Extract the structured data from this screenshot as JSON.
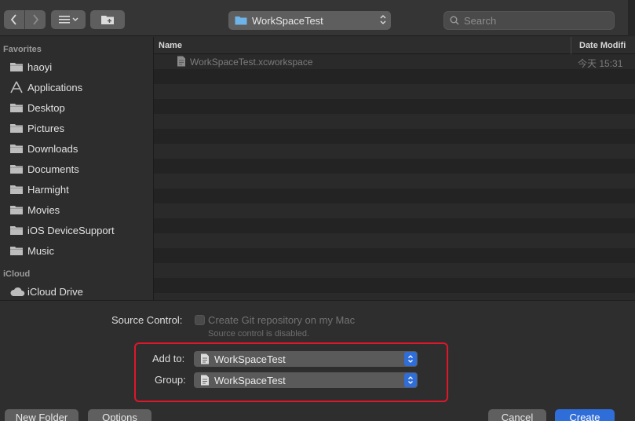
{
  "toolbar": {
    "back_icon": "chevron-left-icon",
    "forward_icon": "chevron-right-icon",
    "view_icon": "list-view-icon",
    "new_folder_icon": "folder-plus-icon",
    "location": "WorkSpaceTest",
    "search_placeholder": "Search"
  },
  "sidebar": {
    "favorites_heading": "Favorites",
    "favorites": [
      {
        "label": "haoyi",
        "icon": "folder-icon"
      },
      {
        "label": "Applications",
        "icon": "applications-icon"
      },
      {
        "label": "Desktop",
        "icon": "folder-icon"
      },
      {
        "label": "Pictures",
        "icon": "folder-icon"
      },
      {
        "label": "Downloads",
        "icon": "folder-icon"
      },
      {
        "label": "Documents",
        "icon": "folder-icon"
      },
      {
        "label": "Harmight",
        "icon": "folder-icon"
      },
      {
        "label": "Movies",
        "icon": "folder-icon"
      },
      {
        "label": "iOS DeviceSupport",
        "icon": "folder-icon"
      },
      {
        "label": "Music",
        "icon": "folder-icon"
      }
    ],
    "icloud_heading": "iCloud",
    "icloud": [
      {
        "label": "iCloud Drive",
        "icon": "cloud-icon"
      }
    ]
  },
  "filelist": {
    "columns": {
      "name": "Name",
      "date": "Date Modifi"
    },
    "files": [
      {
        "name": "WorkSpaceTest.xcworkspace",
        "date": "今天 15:31"
      }
    ]
  },
  "options": {
    "source_control_label": "Source Control:",
    "create_git_label": "Create Git repository on my Mac",
    "source_disabled_note": "Source control is disabled.",
    "add_to_label": "Add to:",
    "add_to_value": "WorkSpaceTest",
    "group_label": "Group:",
    "group_value": "WorkSpaceTest"
  },
  "buttons": {
    "new_folder": "New Folder",
    "options": "Options",
    "cancel": "Cancel",
    "create": "Create"
  },
  "colors": {
    "accent": "#2f6ed9",
    "highlight": "#e0162b"
  }
}
